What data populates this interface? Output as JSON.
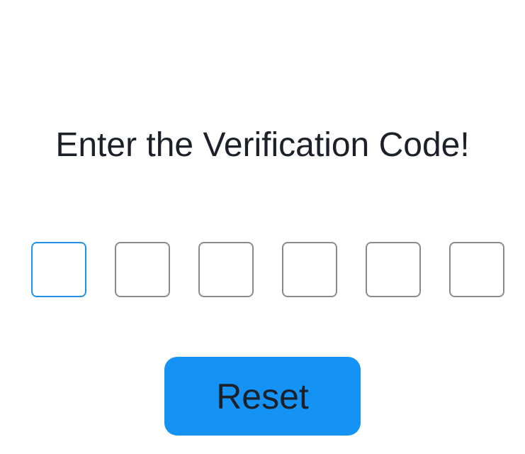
{
  "title": "Enter the Verification Code!",
  "code_inputs": [
    {
      "value": "",
      "state": "focused"
    },
    {
      "value": "",
      "state": "default"
    },
    {
      "value": "",
      "state": "default"
    },
    {
      "value": "",
      "state": "default"
    },
    {
      "value": "",
      "state": "default"
    },
    {
      "value": "",
      "state": "default"
    }
  ],
  "reset_button": {
    "label": "Reset"
  },
  "colors": {
    "accent": "#1593f5",
    "focus_border": "#1c93ea",
    "input_border": "#8a8a8a",
    "text": "#1b2029",
    "background": "#ffffff"
  }
}
